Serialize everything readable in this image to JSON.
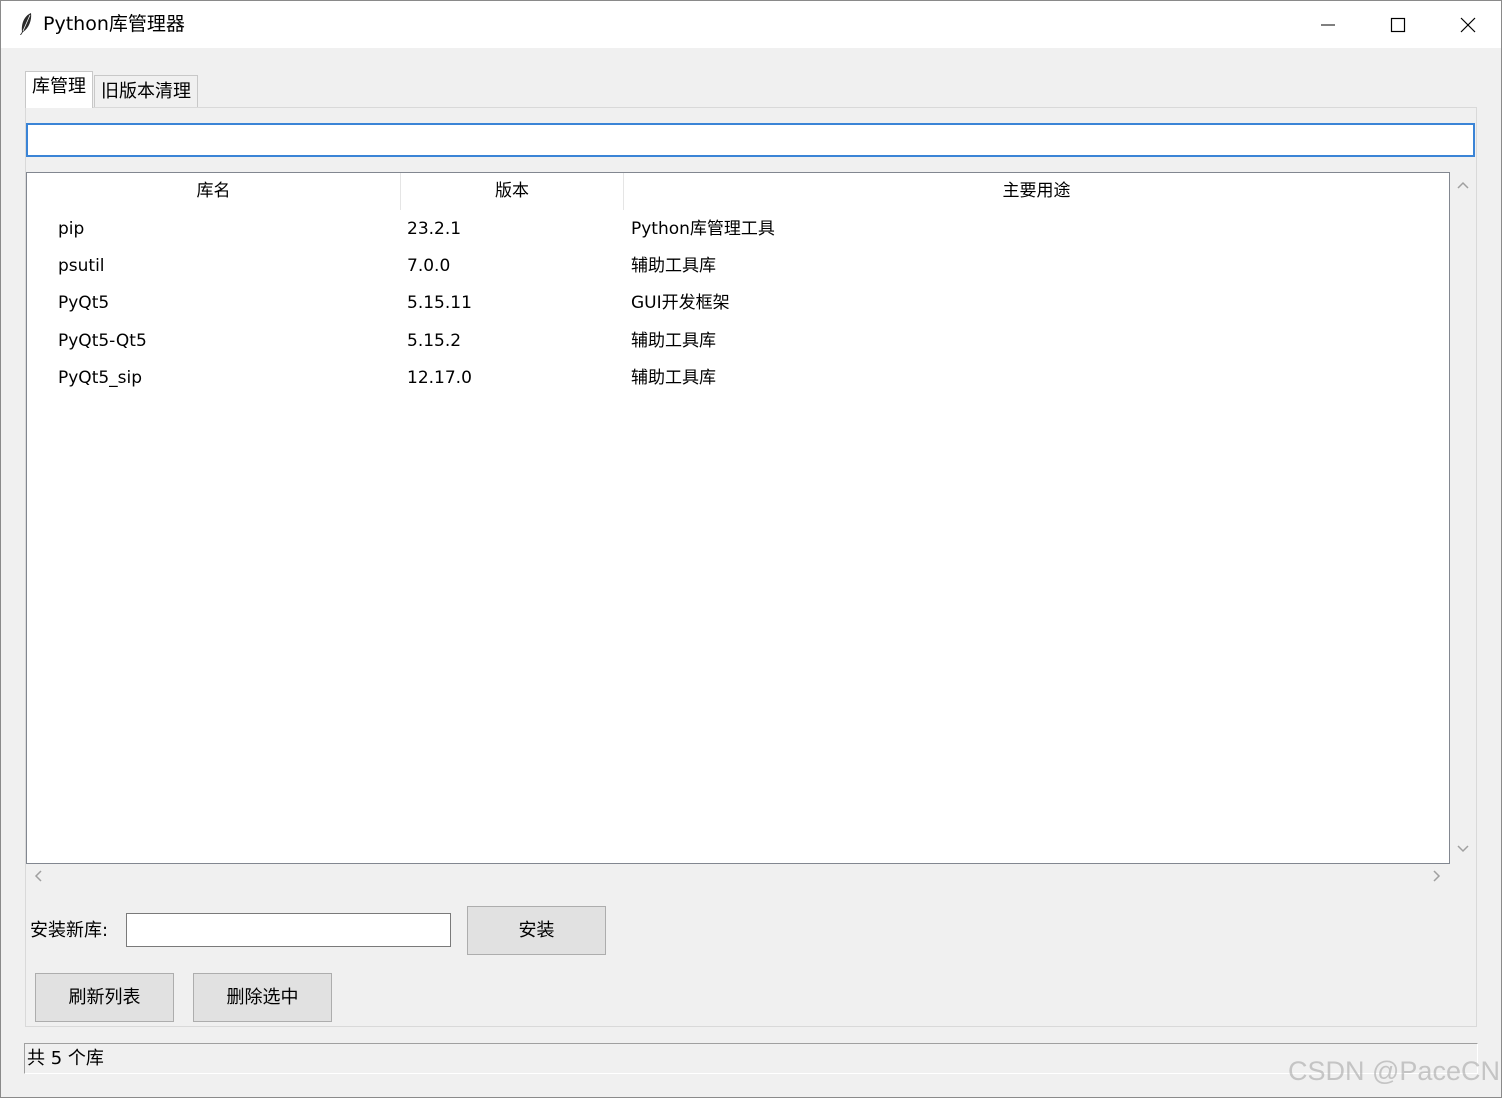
{
  "window": {
    "title": "Python库管理器"
  },
  "tabs": [
    {
      "label": "库管理",
      "active": true
    },
    {
      "label": "旧版本清理",
      "active": false
    }
  ],
  "search": {
    "value": "",
    "placeholder": ""
  },
  "table": {
    "columns": [
      "库名",
      "版本",
      "主要用途"
    ],
    "rows": [
      {
        "name": "pip",
        "version": "23.2.1",
        "purpose": "Python库管理工具"
      },
      {
        "name": "psutil",
        "version": "7.0.0",
        "purpose": "辅助工具库"
      },
      {
        "name": "PyQt5",
        "version": "5.15.11",
        "purpose": "GUI开发框架"
      },
      {
        "name": "PyQt5-Qt5",
        "version": "5.15.2",
        "purpose": "辅助工具库"
      },
      {
        "name": "PyQt5_sip",
        "version": "12.17.0",
        "purpose": "辅助工具库"
      }
    ]
  },
  "install": {
    "label": "安装新库:",
    "value": "",
    "button_label": "安装"
  },
  "actions": {
    "refresh_label": "刷新列表",
    "delete_label": "删除选中"
  },
  "status": {
    "text": "共 5 个库"
  },
  "watermark": "CSDN @PaceCN",
  "colors": {
    "accent": "#3b84d6",
    "button_bg": "#e1e1e1",
    "window_bg": "#f0f0f0"
  },
  "icons": {
    "app": "feather-icon",
    "minimize": "minimize-icon",
    "maximize": "maximize-icon",
    "close": "close-icon"
  }
}
